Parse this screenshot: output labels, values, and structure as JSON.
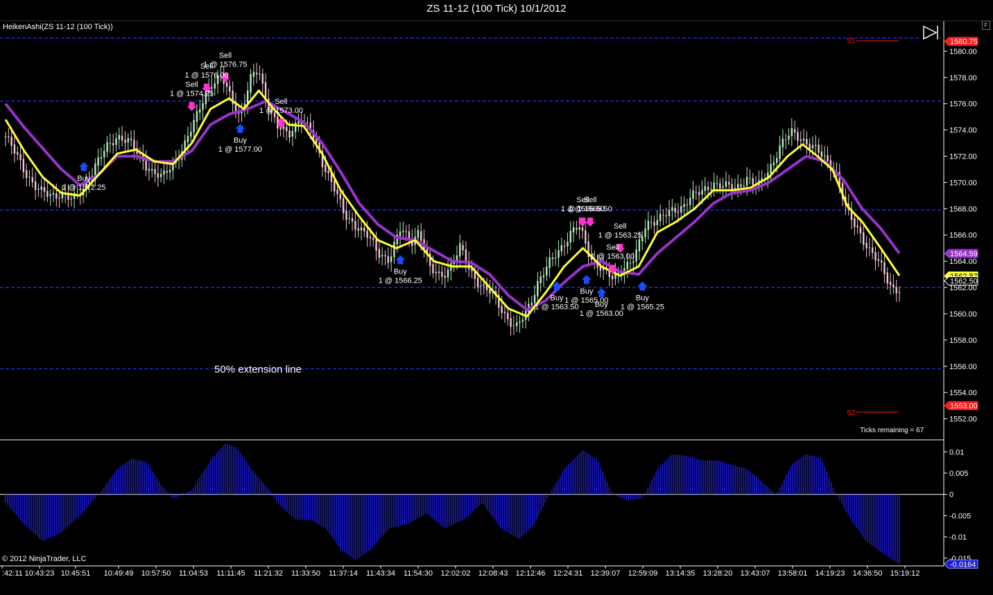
{
  "window": {
    "title": "ZS 11-12 (100 Tick)  10/1/2012",
    "float_button": "F"
  },
  "indicator_label": "HeikenAshi(ZS 11-12 (100 Tick))",
  "copyright": "© 2012 NinjaTrader, LLC",
  "annotation_extension": "50% extension line",
  "ticks_remaining": "Ticks remaining = 67",
  "levels": {
    "s1": "S1",
    "s2": "S2"
  },
  "colors": {
    "background": "#000000",
    "fast_ma": "#ffff33",
    "slow_ma": "#9933cc",
    "bull_candle": "#b8f0c0",
    "bear_candle": "#f4c9d8",
    "hline": "#1a2fd6",
    "histogram": "#1a1ad6",
    "sell_arrow": "#ff33cc",
    "buy_arrow": "#1a4cff",
    "s_level": "#ff1a1a"
  },
  "chart_data": {
    "type": "candlestick",
    "instrument": "ZS 11-12",
    "ylim": [
      1550.5,
      1582
    ],
    "y_ticks": [
      "1580.00",
      "1578.00",
      "1576.00",
      "1574.00",
      "1572.00",
      "1570.00",
      "1568.00",
      "1566.00",
      "1564.00",
      "1562.00",
      "1560.00",
      "1558.00",
      "1556.00",
      "1554.00",
      "1552.00"
    ],
    "x_labels": [
      ":42:11",
      "10:43:23",
      "10:45:51",
      "10:49:49",
      "10:57:50",
      "11:04:53",
      "11:11:45",
      "11:21:32",
      "11:33:50",
      "11:37:14",
      "11:43:34",
      "11:54:30",
      "12:02:02",
      "12:08:43",
      "12:12:46",
      "12:24:31",
      "12:39:07",
      "12:59:09",
      "13:14:35",
      "13:28:20",
      "13:43:07",
      "13:58:01",
      "14:19:23",
      "14:36:50",
      "15:19:12"
    ],
    "horizontal_lines": [
      1581.0,
      1576.2,
      1567.9,
      1562.0,
      1555.8
    ],
    "price_path": [
      [
        0,
        1573.5
      ],
      [
        0.3,
        1572.0
      ],
      [
        0.6,
        1570.5
      ],
      [
        0.9,
        1569.3
      ],
      [
        1.2,
        1569.0
      ],
      [
        1.5,
        1569.2
      ],
      [
        1.8,
        1568.6
      ],
      [
        2.1,
        1569.6
      ],
      [
        2.4,
        1571.2
      ],
      [
        2.7,
        1572.6
      ],
      [
        3.0,
        1573.6
      ],
      [
        3.3,
        1573.1
      ],
      [
        3.6,
        1572.0
      ],
      [
        3.9,
        1570.9
      ],
      [
        4.2,
        1570.3
      ],
      [
        4.5,
        1571.5
      ],
      [
        4.8,
        1572.8
      ],
      [
        5.1,
        1574.8
      ],
      [
        5.4,
        1577.2
      ],
      [
        5.8,
        1578.0
      ],
      [
        6.0,
        1576.8
      ],
      [
        6.3,
        1575.0
      ],
      [
        6.6,
        1578.0
      ],
      [
        6.8,
        1578.6
      ],
      [
        7.0,
        1576.2
      ],
      [
        7.3,
        1574.2
      ],
      [
        7.6,
        1573.6
      ],
      [
        7.9,
        1575.0
      ],
      [
        8.2,
        1573.8
      ],
      [
        8.5,
        1571.6
      ],
      [
        8.8,
        1569.8
      ],
      [
        9.1,
        1567.4
      ],
      [
        9.4,
        1566.8
      ],
      [
        9.7,
        1566.0
      ],
      [
        10.0,
        1564.6
      ],
      [
        10.3,
        1564.2
      ],
      [
        10.6,
        1566.4
      ],
      [
        10.9,
        1565.5
      ],
      [
        11.1,
        1566.4
      ],
      [
        11.4,
        1563.3
      ],
      [
        11.7,
        1562.9
      ],
      [
        12.0,
        1563.8
      ],
      [
        12.2,
        1565.0
      ],
      [
        12.5,
        1563.2
      ],
      [
        12.8,
        1562.0
      ],
      [
        13.1,
        1561.4
      ],
      [
        13.4,
        1560.0
      ],
      [
        13.7,
        1558.8
      ],
      [
        14.0,
        1560.2
      ],
      [
        14.3,
        1562.5
      ],
      [
        14.6,
        1563.8
      ],
      [
        14.9,
        1565.0
      ],
      [
        15.2,
        1566.3
      ],
      [
        15.4,
        1566.6
      ],
      [
        15.7,
        1564.3
      ],
      [
        16.0,
        1563.5
      ],
      [
        16.3,
        1562.6
      ],
      [
        16.6,
        1563.6
      ],
      [
        16.9,
        1564.3
      ],
      [
        17.2,
        1566.8
      ],
      [
        17.5,
        1567.3
      ],
      [
        17.8,
        1567.6
      ],
      [
        18.1,
        1568.0
      ],
      [
        18.4,
        1569.0
      ],
      [
        18.7,
        1569.2
      ],
      [
        19.0,
        1570.0
      ],
      [
        19.3,
        1569.7
      ],
      [
        19.6,
        1569.5
      ],
      [
        19.9,
        1570.4
      ],
      [
        20.2,
        1569.6
      ],
      [
        20.5,
        1571.0
      ],
      [
        20.8,
        1572.8
      ],
      [
        21.1,
        1573.8
      ],
      [
        21.4,
        1573.3
      ],
      [
        21.7,
        1572.6
      ],
      [
        22.0,
        1571.8
      ],
      [
        22.3,
        1570.8
      ],
      [
        22.6,
        1567.6
      ],
      [
        22.9,
        1566.4
      ],
      [
        23.2,
        1564.8
      ],
      [
        23.5,
        1563.6
      ],
      [
        23.8,
        1562.0
      ],
      [
        24.0,
        1561.8
      ]
    ],
    "fast_ma_path": [
      [
        0,
        1574.8
      ],
      [
        0.5,
        1572.4
      ],
      [
        1.0,
        1570.4
      ],
      [
        1.5,
        1569.2
      ],
      [
        2.0,
        1569.0
      ],
      [
        2.5,
        1570.6
      ],
      [
        3.0,
        1572.2
      ],
      [
        3.5,
        1572.5
      ],
      [
        4.0,
        1571.6
      ],
      [
        4.5,
        1571.4
      ],
      [
        5.0,
        1573.0
      ],
      [
        5.5,
        1575.6
      ],
      [
        6.0,
        1576.4
      ],
      [
        6.4,
        1575.6
      ],
      [
        6.8,
        1577.0
      ],
      [
        7.2,
        1575.6
      ],
      [
        7.6,
        1574.4
      ],
      [
        8.0,
        1574.3
      ],
      [
        8.5,
        1572.2
      ],
      [
        9.0,
        1569.4
      ],
      [
        9.5,
        1567.4
      ],
      [
        10.0,
        1565.6
      ],
      [
        10.5,
        1565.0
      ],
      [
        11.0,
        1565.6
      ],
      [
        11.5,
        1564.0
      ],
      [
        12.0,
        1563.6
      ],
      [
        12.5,
        1563.6
      ],
      [
        13.0,
        1562.0
      ],
      [
        13.5,
        1560.4
      ],
      [
        14.0,
        1559.8
      ],
      [
        14.5,
        1561.6
      ],
      [
        15.0,
        1563.6
      ],
      [
        15.5,
        1565.0
      ],
      [
        16.0,
        1563.6
      ],
      [
        16.5,
        1562.9
      ],
      [
        17.0,
        1563.6
      ],
      [
        17.5,
        1566.2
      ],
      [
        18.0,
        1567.0
      ],
      [
        18.5,
        1568.0
      ],
      [
        19.0,
        1569.4
      ],
      [
        19.5,
        1569.4
      ],
      [
        20.0,
        1569.6
      ],
      [
        20.5,
        1570.4
      ],
      [
        21.0,
        1572.0
      ],
      [
        21.4,
        1572.9
      ],
      [
        21.8,
        1572.0
      ],
      [
        22.2,
        1571.0
      ],
      [
        22.6,
        1568.2
      ],
      [
        23.0,
        1567.0
      ],
      [
        23.5,
        1565.0
      ],
      [
        24.0,
        1562.9
      ]
    ],
    "slow_ma_path": [
      [
        0,
        1576.0
      ],
      [
        0.5,
        1574.2
      ],
      [
        1.0,
        1572.6
      ],
      [
        1.5,
        1571.0
      ],
      [
        2.0,
        1569.8
      ],
      [
        2.5,
        1570.6
      ],
      [
        3.0,
        1572.0
      ],
      [
        3.5,
        1572.0
      ],
      [
        4.0,
        1571.6
      ],
      [
        4.5,
        1571.6
      ],
      [
        5.0,
        1572.4
      ],
      [
        5.5,
        1574.4
      ],
      [
        6.0,
        1575.2
      ],
      [
        6.5,
        1575.6
      ],
      [
        7.0,
        1576.2
      ],
      [
        7.5,
        1575.4
      ],
      [
        8.0,
        1574.6
      ],
      [
        8.5,
        1573.0
      ],
      [
        9.0,
        1570.8
      ],
      [
        9.5,
        1568.4
      ],
      [
        10.0,
        1566.8
      ],
      [
        10.5,
        1565.8
      ],
      [
        11.0,
        1565.6
      ],
      [
        11.5,
        1564.8
      ],
      [
        12.0,
        1564.0
      ],
      [
        12.5,
        1563.9
      ],
      [
        13.0,
        1563.0
      ],
      [
        13.5,
        1561.4
      ],
      [
        14.0,
        1560.3
      ],
      [
        14.5,
        1561.0
      ],
      [
        15.0,
        1562.4
      ],
      [
        15.5,
        1563.6
      ],
      [
        16.0,
        1564.0
      ],
      [
        16.5,
        1563.2
      ],
      [
        17.0,
        1563.0
      ],
      [
        17.5,
        1564.6
      ],
      [
        18.0,
        1565.8
      ],
      [
        18.5,
        1567.0
      ],
      [
        19.0,
        1568.4
      ],
      [
        19.5,
        1569.2
      ],
      [
        20.0,
        1569.4
      ],
      [
        20.5,
        1570.0
      ],
      [
        21.0,
        1571.0
      ],
      [
        21.5,
        1572.0
      ],
      [
        22.0,
        1571.6
      ],
      [
        22.5,
        1570.2
      ],
      [
        23.0,
        1568.0
      ],
      [
        23.5,
        1566.5
      ],
      [
        24.0,
        1564.6
      ]
    ],
    "price_labels": [
      {
        "text": "1580.75",
        "value": 1580.75,
        "bg": "#ff1a1a",
        "fg": "#ffffff"
      },
      {
        "text": "1564.59",
        "value": 1564.59,
        "bg": "#9933cc",
        "fg": "#ffffff"
      },
      {
        "text": "1562.87",
        "value": 1562.87,
        "bg": "#ffff33",
        "fg": "#000000"
      },
      {
        "text": "1562.50",
        "value": 1562.5,
        "bg": "#000000",
        "fg": "#ffffff"
      },
      {
        "text": "1553.00",
        "value": 1553.0,
        "bg": "#ff1a1a",
        "fg": "#ffffff"
      }
    ],
    "trades": [
      {
        "side": "Sell",
        "fill": "1 @ 1576.75",
        "x": 5.9,
        "y": 1577.8
      },
      {
        "side": "Sell",
        "fill": "1 @ 1576.00",
        "x": 5.4,
        "y": 1577.0
      },
      {
        "side": "Sell",
        "fill": "1 @ 1574.25",
        "x": 5.0,
        "y": 1575.6
      },
      {
        "side": "Buy",
        "fill": "1 @ 1577.00",
        "x": 6.3,
        "y": 1574.3
      },
      {
        "side": "Sell",
        "fill": "1 @ 1573.00",
        "x": 7.4,
        "y": 1574.3
      },
      {
        "side": "Buy",
        "fill": "1 @ 1572.25",
        "x": 2.1,
        "y": 1571.4
      },
      {
        "side": "Buy",
        "fill": "1 @ 1566.25",
        "x": 10.6,
        "y": 1564.3
      },
      {
        "side": "Sell",
        "fill": "1 @ 1566.50",
        "x": 15.5,
        "y": 1566.8
      },
      {
        "side": "Sell",
        "fill": "1 @ 1566.50",
        "x": 15.7,
        "y": 1566.8
      },
      {
        "side": "Sell",
        "fill": "1 @ 1563.25",
        "x": 16.5,
        "y": 1564.8
      },
      {
        "side": "Sell",
        "fill": "1 @ 1563.00",
        "x": 16.3,
        "y": 1563.2
      },
      {
        "side": "Buy",
        "fill": "1 @ 1563.50",
        "x": 14.8,
        "y": 1562.3
      },
      {
        "side": "Buy",
        "fill": "1 @ 1565.00",
        "x": 15.6,
        "y": 1562.8
      },
      {
        "side": "Buy",
        "fill": "1 @ 1563.00",
        "x": 16.0,
        "y": 1561.8
      },
      {
        "side": "Buy",
        "fill": "1 @ 1565.25",
        "x": 17.1,
        "y": 1562.3
      }
    ],
    "oscillator": {
      "ylim": [
        -0.0165,
        0.0125
      ],
      "y_ticks": [
        "0.01",
        "0.005",
        "0",
        "-0.005",
        "-0.01",
        "-0.015"
      ],
      "last_value": "-0.0164",
      "path": [
        [
          0,
          -0.002
        ],
        [
          0.5,
          -0.007
        ],
        [
          1.0,
          -0.011
        ],
        [
          1.5,
          -0.009
        ],
        [
          2.0,
          -0.005
        ],
        [
          2.5,
          0.0
        ],
        [
          3.0,
          0.006
        ],
        [
          3.4,
          0.0085
        ],
        [
          3.8,
          0.0075
        ],
        [
          4.2,
          0.002
        ],
        [
          4.5,
          -0.001
        ],
        [
          5.0,
          0.001
        ],
        [
          5.5,
          0.008
        ],
        [
          5.9,
          0.012
        ],
        [
          6.2,
          0.011
        ],
        [
          6.6,
          0.006
        ],
        [
          7.0,
          0.002
        ],
        [
          7.4,
          -0.003
        ],
        [
          7.8,
          -0.006
        ],
        [
          8.2,
          -0.006
        ],
        [
          8.6,
          -0.008
        ],
        [
          9.0,
          -0.013
        ],
        [
          9.4,
          -0.0155
        ],
        [
          9.8,
          -0.013
        ],
        [
          10.3,
          -0.008
        ],
        [
          10.8,
          -0.007
        ],
        [
          11.3,
          -0.0045
        ],
        [
          11.8,
          -0.008
        ],
        [
          12.3,
          -0.006
        ],
        [
          12.8,
          -0.002
        ],
        [
          13.3,
          -0.008
        ],
        [
          13.8,
          -0.0105
        ],
        [
          14.2,
          -0.007
        ],
        [
          14.6,
          0.0
        ],
        [
          15.0,
          0.006
        ],
        [
          15.5,
          0.0105
        ],
        [
          15.9,
          0.008
        ],
        [
          16.3,
          0.0
        ],
        [
          16.7,
          -0.0015
        ],
        [
          17.1,
          -0.001
        ],
        [
          17.5,
          0.006
        ],
        [
          17.9,
          0.0095
        ],
        [
          18.3,
          0.009
        ],
        [
          18.7,
          0.008
        ],
        [
          19.1,
          0.008
        ],
        [
          19.5,
          0.007
        ],
        [
          19.9,
          0.006
        ],
        [
          20.3,
          0.003
        ],
        [
          20.7,
          0.0
        ],
        [
          21.1,
          0.007
        ],
        [
          21.5,
          0.0095
        ],
        [
          21.9,
          0.0085
        ],
        [
          22.3,
          0.0
        ],
        [
          22.7,
          -0.006
        ],
        [
          23.1,
          -0.011
        ],
        [
          23.5,
          -0.0135
        ],
        [
          24.0,
          -0.0164
        ]
      ]
    }
  }
}
